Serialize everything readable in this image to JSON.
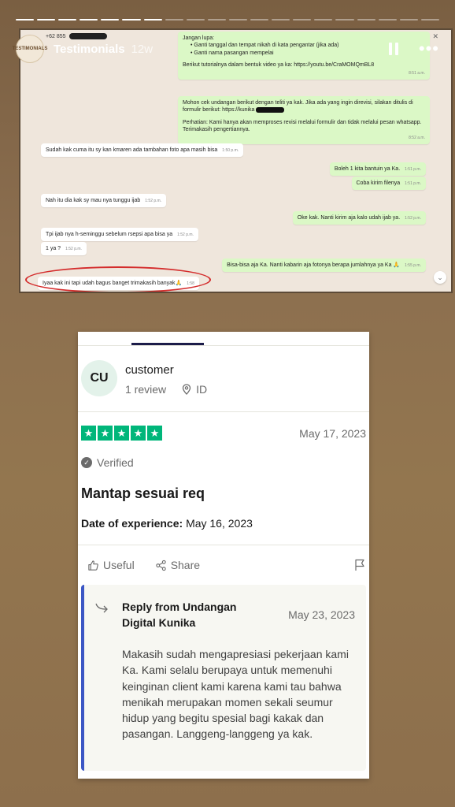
{
  "story": {
    "title": "Testimonials",
    "time": "12w",
    "avatar_label": "TESTIMONIALS",
    "segments_total": 20,
    "segments_done": 7
  },
  "whatsapp": {
    "contact": "+62 855",
    "messages": [
      {
        "dir": "out",
        "lines": [
          "Jangan lupa:",
          "• Ganti tanggal dan tempat nikah di kata pengantar (jika ada)",
          "• Ganti nama pasangan mempelai",
          "",
          "Berikut tutorialnya dalam bentuk video ya ka: https://youtu.be/CraMOMQmBL8"
        ],
        "time": "8:51 a.m."
      },
      {
        "dir": "out",
        "lines": [
          "Mohon cek undangan berikut dengan teliti ya kak. Jika ada yang ingin direvisi, silakan ditulis di formulir berikut: https://kunika",
          "",
          "Perhatian: Kami hanya akan memproses revisi melalui formulir dan tidak melalui pesan whatsapp. Terimakasih pengertiannya."
        ],
        "time": "8:52 a.m."
      },
      {
        "dir": "in",
        "text": "Sudah kak cuma itu sy kan kmaren ada tambahan foto apa masih bisa",
        "time": "1:50 p.m."
      },
      {
        "dir": "out",
        "text": "Boleh 1 kita bantuin ya Ka.",
        "time": "1:51 p.m."
      },
      {
        "dir": "out",
        "text": "Coba kirim filenya",
        "time": "1:51 p.m."
      },
      {
        "dir": "in",
        "text": "Nah itu dia kak sy mau nya tunggu ijab",
        "time": "1:52 p.m."
      },
      {
        "dir": "out",
        "text": "Oke kak. Nanti kirim aja kalo udah ijab ya.",
        "time": "1:52 p.m."
      },
      {
        "dir": "in",
        "text": "Tpi ijab nya h-seminggu sebelum rsepsi apa bisa ya",
        "time": "1:52 p.m."
      },
      {
        "dir": "in",
        "text": "1 ya ?",
        "time": "1:52 p.m."
      },
      {
        "dir": "out",
        "text": "Bisa-bisa aja Ka. Nanti kabarin aja fotonya berapa jumlahnya ya Ka 🙏",
        "time": "1:55 p.m."
      },
      {
        "dir": "in",
        "text": "Iyaa kak ini tapi udah bagus banget trimakasih banyak🙏",
        "time": "1:58"
      }
    ]
  },
  "review": {
    "avatar_initials": "CU",
    "reviewer_name": "customer",
    "review_count": "1 review",
    "country": "ID",
    "rating": 5,
    "date": "May 17, 2023",
    "verified_label": "Verified",
    "title": "Mantap sesuai req",
    "experience_label": "Date of experience:",
    "experience_date": "May 16, 2023",
    "useful_label": "Useful",
    "share_label": "Share",
    "reply": {
      "title": "Reply from Undangan Digital Kunika",
      "date": "May 23, 2023",
      "body": "Makasih sudah mengapresiasi pekerjaan kami Ka. Kami selalu berupaya untuk memenuhi keinginan client kami karena kami tau bahwa menikah merupakan momen sekali seumur hidup yang begitu spesial bagi kakak dan pasangan. Langgeng-langgeng ya kak."
    }
  },
  "colors": {
    "story_bg": "#8a6d4e",
    "star_green": "#00b67a",
    "reply_accent": "#3c57c5",
    "wa_out": "#dbf8c6",
    "circle_red": "#d42c2c"
  }
}
